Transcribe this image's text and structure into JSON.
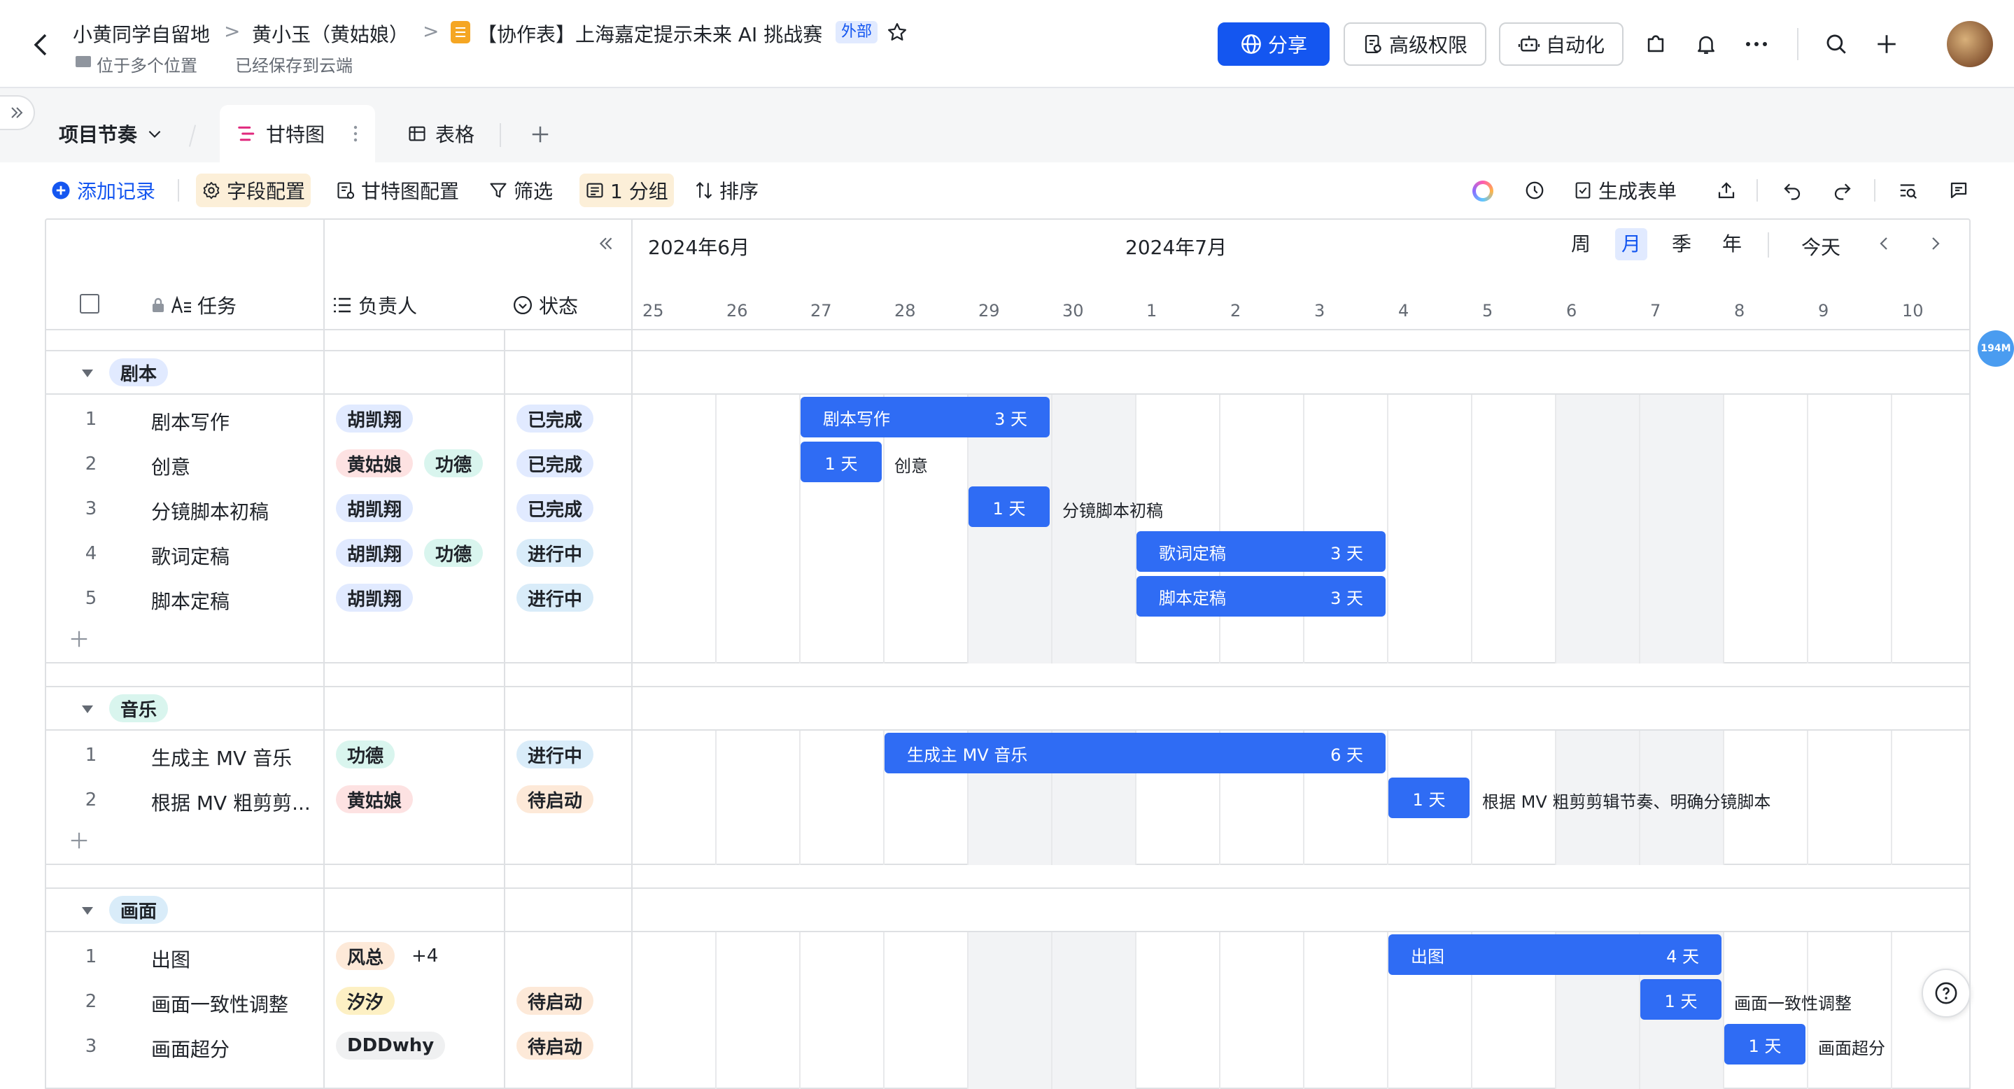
{
  "breadcrumb": {
    "item1": "小黄同学自留地",
    "sep1": ">",
    "item2": "黄小玉（黄姑娘）",
    "sep2": ">",
    "doc_title": "【协作表】上海嘉定提示未来 AI 挑战赛",
    "external_badge": "外部"
  },
  "sub": {
    "location": "位于多个位置",
    "save_status": "已经保存到云端"
  },
  "header_buttons": {
    "share": "分享",
    "permissions": "高级权限",
    "automation": "自动化"
  },
  "view": {
    "project_dropdown": "项目节奏",
    "tabs": [
      {
        "label": "甘特图"
      },
      {
        "label": "表格"
      }
    ]
  },
  "toolbar": {
    "add_record": "添加记录",
    "field_config": "字段配置",
    "gantt_config": "甘特图配置",
    "filter": "筛选",
    "group": "1 分组",
    "sort": "排序",
    "generate_form": "生成表单"
  },
  "columns": {
    "task": "任务",
    "owner": "负责人",
    "status": "状态"
  },
  "timeline": {
    "month_june": "2024年6月",
    "month_july": "2024年7月",
    "scale": [
      "周",
      "月",
      "季",
      "年"
    ],
    "today": "今天",
    "days": [
      "25",
      "26",
      "27",
      "28",
      "29",
      "30",
      "1",
      "2",
      "3",
      "4",
      "5",
      "6",
      "7",
      "8",
      "9",
      "10"
    ]
  },
  "memory_badge": "194M",
  "groups": [
    {
      "name": "剧本",
      "color": "#e1eaff",
      "rows": [
        {
          "num": "1",
          "task": "剧本写作",
          "owners": [
            {
              "n": "胡凯翔",
              "c": "#e1eaff"
            }
          ],
          "status": {
            "t": "已完成",
            "c": "#e1eaff"
          },
          "bar": {
            "label": "剧本写作",
            "dur": "3 天"
          }
        },
        {
          "num": "2",
          "task": "创意",
          "owners": [
            {
              "n": "黄姑娘",
              "c": "#fde2e2"
            },
            {
              "n": "功德",
              "c": "#d9f5ee"
            }
          ],
          "status": {
            "t": "已完成",
            "c": "#e1eaff"
          },
          "bar": {
            "label": "",
            "dur": "1 天",
            "after": "创意"
          }
        },
        {
          "num": "3",
          "task": "分镜脚本初稿",
          "owners": [
            {
              "n": "胡凯翔",
              "c": "#e1eaff"
            }
          ],
          "status": {
            "t": "已完成",
            "c": "#e1eaff"
          },
          "bar": {
            "label": "",
            "dur": "1 天",
            "after": "分镜脚本初稿"
          }
        },
        {
          "num": "4",
          "task": "歌词定稿",
          "owners": [
            {
              "n": "胡凯翔",
              "c": "#e1eaff"
            },
            {
              "n": "功德",
              "c": "#d9f5ee"
            }
          ],
          "status": {
            "t": "进行中",
            "c": "#d9ecf9"
          },
          "bar": {
            "label": "歌词定稿",
            "dur": "3 天"
          }
        },
        {
          "num": "5",
          "task": "脚本定稿",
          "owners": [
            {
              "n": "胡凯翔",
              "c": "#e1eaff"
            }
          ],
          "status": {
            "t": "进行中",
            "c": "#d9ecf9"
          },
          "bar": {
            "label": "脚本定稿",
            "dur": "3 天"
          }
        }
      ]
    },
    {
      "name": "音乐",
      "color": "#d9f5ee",
      "rows": [
        {
          "num": "1",
          "task": "生成主 MV 音乐",
          "owners": [
            {
              "n": "功德",
              "c": "#d9f5ee"
            }
          ],
          "status": {
            "t": "进行中",
            "c": "#d9ecf9"
          },
          "bar": {
            "label": "生成主 MV 音乐",
            "dur": "6 天"
          }
        },
        {
          "num": "2",
          "task": "根据 MV 粗剪剪...",
          "owners": [
            {
              "n": "黄姑娘",
              "c": "#fde2e2"
            }
          ],
          "status": {
            "t": "待启动",
            "c": "#fde9d8"
          },
          "bar": {
            "label": "",
            "dur": "1 天",
            "after": "根据 MV 粗剪剪辑节奏、明确分镜脚本"
          }
        }
      ]
    },
    {
      "name": "画面",
      "color": "#d9ecf9",
      "rows": [
        {
          "num": "1",
          "task": "出图",
          "owners": [
            {
              "n": "风总",
              "c": "#fde9d8"
            }
          ],
          "more": "+4",
          "status": null,
          "bar": {
            "label": "出图",
            "dur": "4 天"
          }
        },
        {
          "num": "2",
          "task": "画面一致性调整",
          "owners": [
            {
              "n": "汐汐",
              "c": "#fdf0c4"
            }
          ],
          "status": {
            "t": "待启动",
            "c": "#fde9d8"
          },
          "bar": {
            "label": "",
            "dur": "1 天",
            "after": "画面一致性调整"
          }
        },
        {
          "num": "3",
          "task": "画面超分",
          "owners": [
            {
              "n": "DDDwhy",
              "c": "#eff0f1"
            }
          ],
          "status": {
            "t": "待启动",
            "c": "#fde9d8"
          },
          "bar": {
            "label": "",
            "dur": "1 天",
            "after": "画面超分"
          }
        }
      ]
    }
  ]
}
